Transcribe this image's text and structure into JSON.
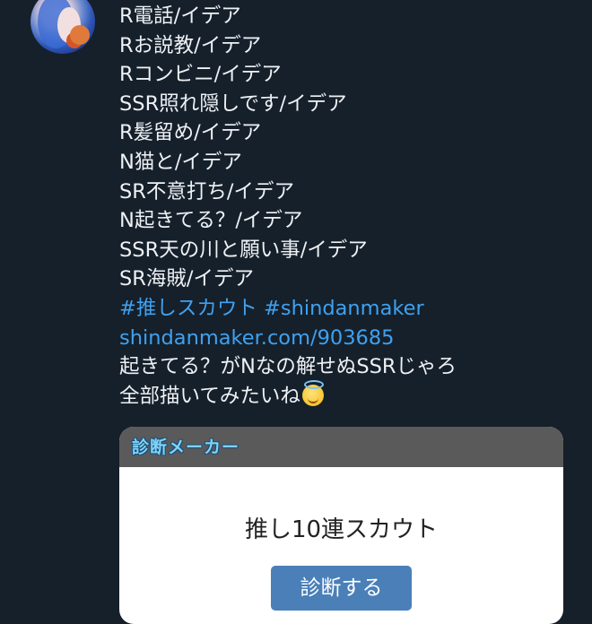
{
  "tweet": {
    "lines": [
      "R電話/イデア",
      "Rお説教/イデア",
      "Rコンビニ/イデア",
      "SSR照れ隠しです/イデア",
      "R髪留め/イデア",
      "N猫と/イデア",
      "SR不意打ち/イデア",
      "N起きてる？/イデア",
      "SSR天の川と願い事/イデア",
      "SR海賊/イデア"
    ],
    "hashtags": "#推しスカウト #shindanmaker",
    "link": "shindanmaker.com/903685",
    "comment1": "起きてる？がNなの解せぬSSRじゃろ",
    "comment2": "全部描いてみたいね"
  },
  "card": {
    "brand": "診断メーカー",
    "title": "推し10連スカウト",
    "button": "診断する"
  },
  "icons": {
    "avatar": "user-avatar",
    "emoji": "smiling-face-with-halo"
  },
  "colors": {
    "background": "#15202b",
    "text": "#eef1f4",
    "link": "#3fa1f0",
    "card_header": "#5a5a5a",
    "button": "#4a7fb8"
  }
}
